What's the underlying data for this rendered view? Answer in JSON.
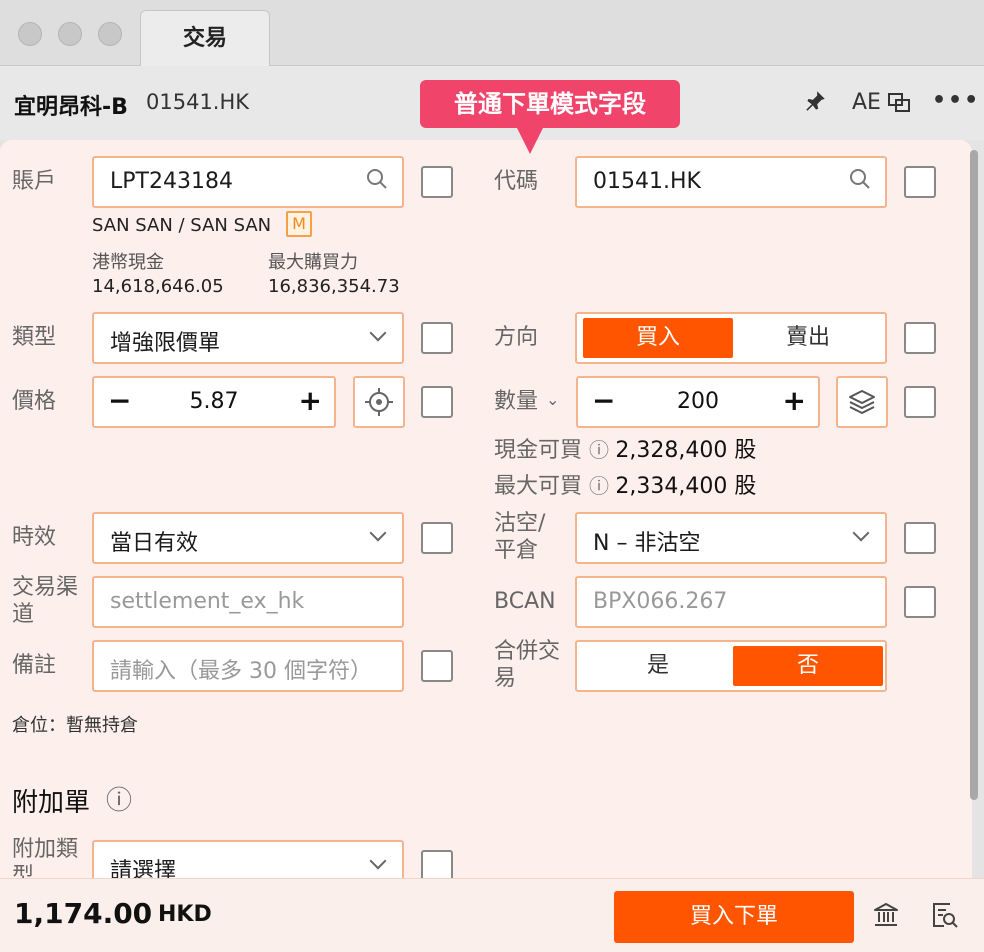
{
  "window": {
    "tab_label": "交易"
  },
  "header": {
    "stock_name": "宜明昂科-B",
    "stock_code": "01541.HK",
    "ae_label": "AE"
  },
  "tooltip": {
    "text": "普通下單模式字段"
  },
  "account": {
    "label": "賬戶",
    "value": "LPT243184",
    "holder": "SAN SAN / SAN SAN",
    "badge": "M",
    "hkd_cash_label": "港幣現金",
    "hkd_cash_value": "14,618,646.05",
    "max_buying_power_label": "最大購買力",
    "max_buying_power_value": "16,836,354.73"
  },
  "code": {
    "label": "代碼",
    "value": "01541.HK"
  },
  "order_type": {
    "label": "類型",
    "value": "增強限價單"
  },
  "direction": {
    "label": "方向",
    "options": [
      "買入",
      "賣出"
    ],
    "selected": "買入"
  },
  "price": {
    "label": "價格",
    "value": "5.87"
  },
  "quantity": {
    "label": "數量",
    "value": "200",
    "cash_buyable_label": "現金可買",
    "cash_buyable_value": "2,328,400 股",
    "max_buyable_label": "最大可買",
    "max_buyable_value": "2,334,400 股"
  },
  "validity": {
    "label": "時效",
    "value": "當日有效"
  },
  "short_sell": {
    "label_line1": "沽空/",
    "label_line2": "平倉",
    "value": "N – 非沽空"
  },
  "channel": {
    "label_line1": "交易渠",
    "label_line2": "道",
    "value": "settlement_ex_hk"
  },
  "bcan": {
    "label": "BCAN",
    "value": "BPX066.267"
  },
  "remarks": {
    "label": "備註",
    "placeholder": "請輸入（最多 30 個字符）"
  },
  "combine": {
    "label_line1": "合併交",
    "label_line2": "易",
    "options": [
      "是",
      "否"
    ],
    "selected": "否"
  },
  "position": {
    "text": "倉位：暫無持倉"
  },
  "attached_order": {
    "title": "附加單",
    "type_label_line1": "附加類",
    "type_label_line2": "型",
    "type_value": "請選擇"
  },
  "footer": {
    "total": "1,174.00",
    "currency": "HKD",
    "submit_label": "買入下單"
  },
  "colors": {
    "accent": "#ff5500",
    "field_border": "#f4b58e",
    "panel_bg": "#fdf0ec",
    "tooltip": "#f0446a"
  }
}
